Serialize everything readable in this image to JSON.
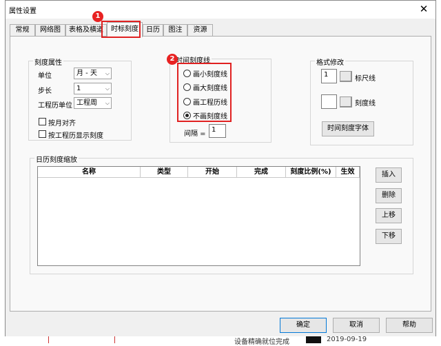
{
  "background": {
    "bottom_text": "设备精确就位完成",
    "bottom_date": "2019-09-19"
  },
  "dialog": {
    "title": "属性设置",
    "close_label": "✕",
    "tabs": [
      "常规",
      "网络图",
      "表格及横道",
      "时标刻度",
      "日历",
      "图注",
      "资源"
    ],
    "active_tab": "时标刻度"
  },
  "annotations": [
    "1",
    "2"
  ],
  "scale_props": {
    "title": "刻度属性",
    "unit_label": "单位",
    "unit_value": "月 - 天",
    "step_label": "步长",
    "step_value": "1",
    "calendar_unit_label": "工程历单位",
    "calendar_unit_value": "工程周",
    "align_month_label": "按月对齐",
    "show_by_calendar_label": "按工程历显示刻度"
  },
  "scale_lines": {
    "title": "时间刻度线",
    "options": [
      "画小刻度线",
      "画大刻度线",
      "画工程历线",
      "不画刻度线"
    ],
    "selected_index": 3,
    "interval_label": "间隔 =",
    "interval_value": "1"
  },
  "format": {
    "title": "格式修改",
    "ruler_value": "1",
    "ruler_label": "标尺线",
    "scale_line_label": "刻度线",
    "font_button": "时间刻度字体"
  },
  "calendar_zoom": {
    "title": "日历刻度缩放",
    "columns": [
      "名称",
      "类型",
      "开始",
      "完成",
      "刻度比例(%)",
      "生效"
    ],
    "buttons": [
      "插入",
      "删除",
      "上移",
      "下移"
    ]
  },
  "footer": {
    "ok": "确定",
    "cancel": "取消",
    "help": "帮助"
  }
}
